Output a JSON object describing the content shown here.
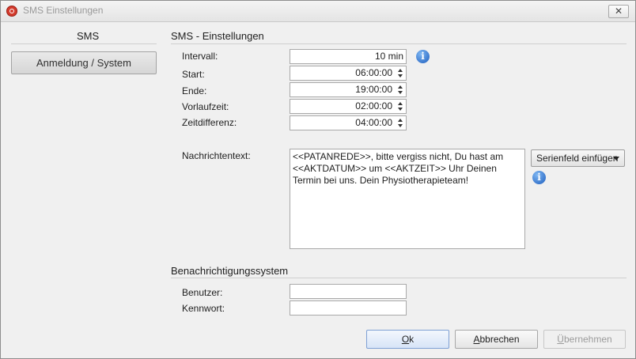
{
  "window": {
    "title": "SMS Einstellungen",
    "close_glyph": "✕"
  },
  "sidebar": {
    "heading": "SMS",
    "items": [
      {
        "label": "Anmeldung / System",
        "selected": true
      }
    ]
  },
  "sms_settings": {
    "heading": "SMS - Einstellungen",
    "interval": {
      "label": "Intervall:",
      "value": "10 min"
    },
    "start": {
      "label": "Start:",
      "value": "06:00:00"
    },
    "end": {
      "label": "Ende:",
      "value": "19:00:00"
    },
    "lead_time": {
      "label": "Vorlaufzeit:",
      "value": "02:00:00"
    },
    "time_offset": {
      "label": "Zeitdifferenz:",
      "value": "04:00:00"
    },
    "message": {
      "label": "Nachrichtentext:",
      "value": "<<PATANREDE>>, bitte vergiss nicht, Du hast am <<AKTDATUM>> um <<AKTZEIT>> Uhr Deinen Termin bei uns. Dein Physiotherapieteam!"
    },
    "insert_field_button": "Serienfeld einfügen",
    "info_glyph": "i"
  },
  "notification_system": {
    "heading": "Benachrichtigungssystem",
    "user": {
      "label": "Benutzer:",
      "value": ""
    },
    "password": {
      "label": "Kennwort:",
      "value": ""
    }
  },
  "footer": {
    "ok": {
      "mnemonic": "O",
      "rest": "k"
    },
    "cancel": {
      "mnemonic": "A",
      "rest": "bbrechen"
    },
    "apply": {
      "mnemonic": "Ü",
      "rest": "bernehmen",
      "enabled": false
    }
  },
  "colors": {
    "accent": "#1f5fbf",
    "primary_button_border": "#7ea0d4",
    "disabled_text": "#9b9b9b"
  },
  "icons": {
    "app": "app-logo-icon",
    "close": "close-icon",
    "info": "info-icon",
    "dropdown": "chevron-down-icon",
    "spin_up": "spin-up-icon",
    "spin_down": "spin-down-icon"
  }
}
